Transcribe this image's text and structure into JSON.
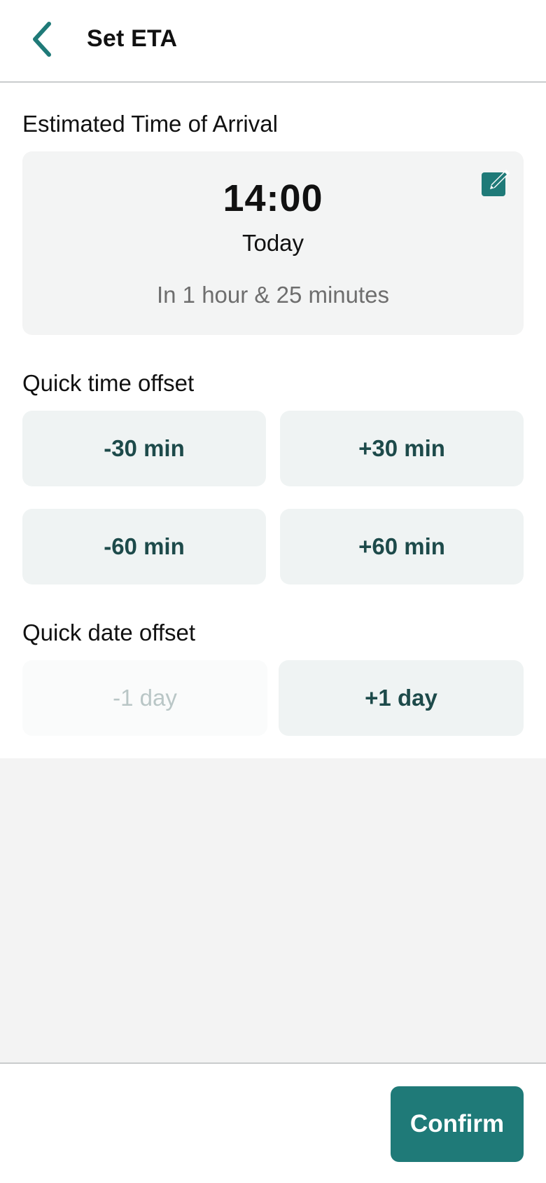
{
  "header": {
    "title": "Set ETA",
    "back_icon": "chevron-left-icon"
  },
  "eta": {
    "section_label": "Estimated Time of Arrival",
    "time": "14:00",
    "day": "Today",
    "relative": "In 1 hour & 25 minutes",
    "edit_icon": "edit-pencil-icon"
  },
  "time_offset": {
    "label": "Quick time offset",
    "buttons": [
      "-30 min",
      "+30 min",
      "-60 min",
      "+60 min"
    ]
  },
  "date_offset": {
    "label": "Quick date offset",
    "buttons": [
      {
        "label": "-1 day",
        "disabled": true
      },
      {
        "label": "+1 day",
        "disabled": false
      }
    ]
  },
  "footer": {
    "confirm_label": "Confirm"
  },
  "colors": {
    "accent": "#1f7a78",
    "button_bg": "#eff3f3",
    "button_text": "#1d4a4a",
    "disabled_text": "#b9c6c6"
  }
}
